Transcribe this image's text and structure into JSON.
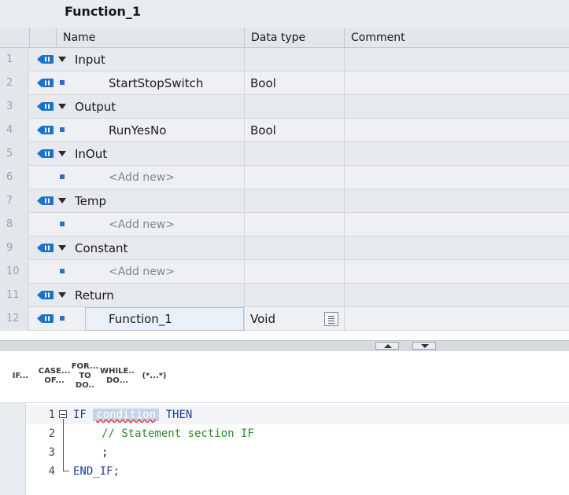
{
  "block": {
    "title": "Function_1"
  },
  "table": {
    "columns": [
      "Name",
      "Data type",
      "Comment"
    ],
    "rows": [
      {
        "num": "1",
        "name": "Input",
        "type": "",
        "kind": "section"
      },
      {
        "num": "2",
        "name": "StartStopSwitch",
        "type": "Bool",
        "kind": "var"
      },
      {
        "num": "3",
        "name": "Output",
        "type": "",
        "kind": "section"
      },
      {
        "num": "4",
        "name": "RunYesNo",
        "type": "Bool",
        "kind": "var"
      },
      {
        "num": "5",
        "name": "InOut",
        "type": "",
        "kind": "section"
      },
      {
        "num": "6",
        "name": "<Add new>",
        "type": "",
        "kind": "addnew"
      },
      {
        "num": "7",
        "name": "Temp",
        "type": "",
        "kind": "section"
      },
      {
        "num": "8",
        "name": "<Add new>",
        "type": "",
        "kind": "addnew"
      },
      {
        "num": "9",
        "name": "Constant",
        "type": "",
        "kind": "section"
      },
      {
        "num": "10",
        "name": "<Add new>",
        "type": "",
        "kind": "addnew"
      },
      {
        "num": "11",
        "name": "Return",
        "type": "",
        "kind": "section"
      },
      {
        "num": "12",
        "name": "Function_1",
        "type": "Void",
        "kind": "var"
      }
    ]
  },
  "toolbar": {
    "if_label": "IF...",
    "case_top": "CASE...",
    "case_bottom": "OF...",
    "for_top": "FOR...",
    "for_bottom": "TO DO..",
    "while_top": "WHILE..",
    "while_bottom": "DO...",
    "comment_label": "(*...*)"
  },
  "code": {
    "lines": [
      {
        "num": "1",
        "kw1": "IF",
        "cond": "condition",
        "kw2": "THEN"
      },
      {
        "num": "2",
        "text": "// Statement section IF"
      },
      {
        "num": "3",
        "text": ";"
      },
      {
        "num": "4",
        "kw1": "END_IF;"
      }
    ]
  },
  "icons": {
    "io_icon": "interface-io-icon",
    "expand": "triangle-down-icon",
    "var_marker": "blue-square-icon",
    "doc_button": "detail-icon"
  }
}
